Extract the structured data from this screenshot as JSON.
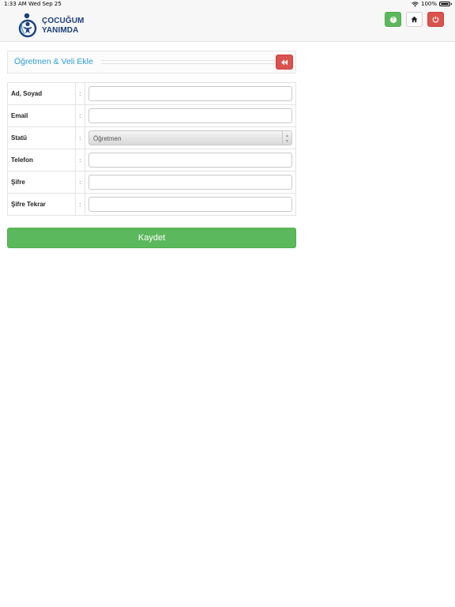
{
  "status_bar": {
    "time": "1:33 AM",
    "date": "Wed Sep 25",
    "battery": "100%"
  },
  "header": {
    "logo_line1": "ÇOCUĞUM",
    "logo_line2": "YANIMDA",
    "buttons": [
      {
        "icon": "help-icon",
        "color": "#5cb85c"
      },
      {
        "icon": "home-icon",
        "color": "#ffffff"
      },
      {
        "icon": "power-icon",
        "color": "#d9534f"
      }
    ]
  },
  "panel": {
    "title": "Öğretmen & Veli Ekle",
    "back_icon": "double-chevron-left-icon"
  },
  "form": {
    "separator": ":",
    "rows": [
      {
        "label": "Ad, Soyad",
        "value": ""
      },
      {
        "label": "Email",
        "value": ""
      },
      {
        "label": "Statü",
        "value": "Öğretmen"
      },
      {
        "label": "Telefon",
        "value": ""
      },
      {
        "label": "Şifre",
        "value": ""
      },
      {
        "label": "Şifre Tekrar",
        "value": ""
      }
    ]
  },
  "save_label": "Kaydet",
  "colors": {
    "accent_blue": "#2d9bd6",
    "success": "#5cb85c",
    "danger": "#d9534f",
    "brand_navy": "#1c3f7a"
  }
}
